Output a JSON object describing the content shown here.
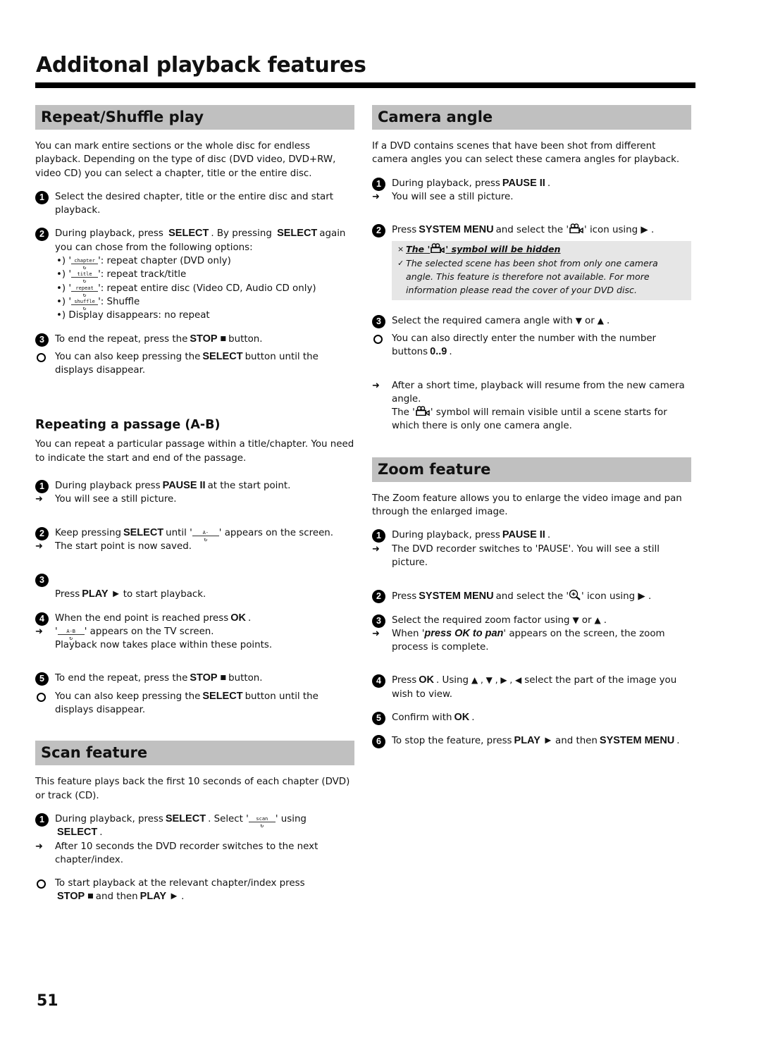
{
  "page": {
    "title": "Additonal playback features",
    "page_number": "51"
  },
  "repeat": {
    "heading": "Repeat/Shuffle play",
    "intro": "You can mark entire sections or the whole disc for endless playback. Depending on the type of disc (DVD video, DVD+RW, video CD) you can select a chapter, title or the entire disc.",
    "step1": "Select the desired chapter, title or the entire disc and start playback.",
    "step2_a": "During playback, press",
    "step2_kw1": "SELECT",
    "step2_b": ". By pressing",
    "step2_kw2": "SELECT",
    "step2_c": "again you can chose from the following options:",
    "options": [
      {
        "osd": "chapter",
        "text": ": repeat chapter (DVD only)"
      },
      {
        "osd": "title",
        "text": ": repeat track/title"
      },
      {
        "osd": "repeat",
        "text": ": repeat entire disc (Video CD, Audio CD only)"
      },
      {
        "osd": "shuffle",
        "text": ": Shuffle"
      }
    ],
    "option_none": "Display disappears: no repeat",
    "bullet": "•)",
    "step3_a": "To end the repeat, press the",
    "step3_kw": "STOP ■",
    "step3_b": "button.",
    "step3_tip_a": "You can also keep pressing the",
    "step3_tip_kw": "SELECT",
    "step3_tip_b": "button until the displays disappear."
  },
  "ab": {
    "heading": "Repeating a passage (A-B)",
    "intro": "You can repeat a particular passage within a title/chapter. You need to indicate the start and end of the passage.",
    "s1_a": "During playback press",
    "s1_kw": "PAUSE II",
    "s1_b": "at the start point.",
    "s1_result": "You will see a still picture.",
    "s2_a": "Keep pressing",
    "s2_kw": "SELECT",
    "s2_b": "until '",
    "s2_osd": "A-",
    "s2_c": "' appears on the screen.",
    "s2_result": "The start point is now saved.",
    "s3_a": "Press",
    "s3_kw": "PLAY ►",
    "s3_b": "to start playback.",
    "s4_a": "When the end point is reached press",
    "s4_kw": "OK",
    "s4_b": ".",
    "s4_osd": "A-B",
    "s4_result": "' appears on the TV screen.",
    "s4_result2": "Playback now takes place within these points.",
    "s5_a": "To end the repeat, press the",
    "s5_kw": "STOP ■",
    "s5_b": "button.",
    "s5_tip_a": "You can also keep pressing the",
    "s5_tip_kw": "SELECT",
    "s5_tip_b": "button until the displays disappear."
  },
  "scan": {
    "heading": "Scan feature",
    "intro": "This feature plays back the first 10 seconds of each chapter (DVD) or track (CD).",
    "s1_a": "During playback, press",
    "s1_kw": "SELECT",
    "s1_b": ". Select '",
    "s1_osd": "scan",
    "s1_c": "' using",
    "s1_kw2": "SELECT",
    "s1_d": ".",
    "s1_result": "After 10 seconds the DVD recorder switches to the next chapter/index.",
    "tip_a": "To start playback at the relevant chapter/index press",
    "tip_kw1": "STOP ■",
    "tip_b": "and then",
    "tip_kw2": "PLAY ►",
    "tip_c": "."
  },
  "camera": {
    "heading": "Camera angle",
    "intro": "If a DVD contains scenes that have been shot from different camera angles you can select these camera angles for playback.",
    "s1_a": "During playback, press",
    "s1_kw": "PAUSE II",
    "s1_b": ".",
    "s1_result": "You will see a still picture.",
    "s2_a": "Press",
    "s2_kw": "SYSTEM MENU",
    "s2_b": "and select the '",
    "s2_c": "' icon using",
    "s2_d": "▶ .",
    "note_title_a": "The '",
    "note_title_b": "' symbol will be hidden",
    "note_body": "The selected scene has been shot from only one camera angle. This feature is therefore not available. For more information please read the cover of your DVD disc.",
    "note_x": "×",
    "note_check": "✓",
    "s3_a": "Select the required camera angle with",
    "s3_down": "▼",
    "s3_or": "or",
    "s3_up": "▲",
    "s3_b": ".",
    "tip_a": "You can also directly enter the number with the number buttons",
    "tip_kw": "0..9",
    "tip_b": ".",
    "result1": "After a short time, playback will resume from the new camera angle.",
    "result2_a": "The '",
    "result2_b": "' symbol will remain visible until a scene starts for which there is only one camera angle."
  },
  "zoom": {
    "heading": "Zoom feature",
    "intro": "The Zoom feature allows you to enlarge the video image and pan through the enlarged image.",
    "s1_a": "During playback, press",
    "s1_kw": "PAUSE II",
    "s1_b": ".",
    "s1_result": "The DVD recorder switches to 'PAUSE'. You will see a still picture.",
    "s2_a": "Press",
    "s2_kw": "SYSTEM MENU",
    "s2_b": "and select the '",
    "s2_c": "' icon using",
    "s2_d": "▶ .",
    "s3_a": "Select the required zoom factor using",
    "s3_down": "▼",
    "s3_or": "or",
    "s3_up": "▲",
    "s3_b": ".",
    "s3_result_a": "When '",
    "s3_result_kw": "press OK to pan",
    "s3_result_b": "' appears on the screen, the zoom process is complete.",
    "s4_a": "Press",
    "s4_kw": "OK",
    "s4_b": ". Using",
    "s4_arrows": "▲ , ▼ , ▶ , ◀",
    "s4_c": "select the part of the image you wish to view.",
    "s5_a": "Confirm with",
    "s5_kw": "OK",
    "s5_b": ".",
    "s6_a": "To stop the feature, press",
    "s6_kw": "PLAY ►",
    "s6_b": "and then",
    "s6_kw2": "SYSTEM MENU",
    "s6_c": "."
  },
  "marks": {
    "arrow": "➜",
    "n1": "1",
    "n2": "2",
    "n3": "3",
    "n4": "4",
    "n5": "5",
    "n6": "6"
  }
}
